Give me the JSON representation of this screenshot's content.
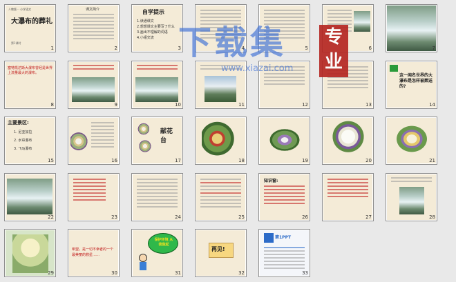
{
  "slides": [
    {
      "n": "1",
      "title": "大瀑布的葬礼"
    },
    {
      "n": "2",
      "text": "课文简介"
    },
    {
      "n": "3",
      "title": "自学提示",
      "items": [
        "1.读通课文",
        "2.想想课文主要写了什么",
        "3.画出不理解的词语",
        "4.小组交流"
      ]
    },
    {
      "n": "4"
    },
    {
      "n": "5"
    },
    {
      "n": "6"
    },
    {
      "n": "7"
    },
    {
      "n": "8",
      "text": "塞特凯达斯大瀑布曾经是世界上流量最大的瀑布。"
    },
    {
      "n": "9"
    },
    {
      "n": "10"
    },
    {
      "n": "11"
    },
    {
      "n": "12"
    },
    {
      "n": "13"
    },
    {
      "n": "14",
      "text": "这一闻名世界的大瀑布是怎样被葬送的?"
    },
    {
      "n": "15",
      "title": "主要景区:",
      "items": [
        "1. 尼亚加拉",
        "2. 水帘瀑布",
        "3. 飞马瀑布"
      ]
    },
    {
      "n": "16"
    },
    {
      "n": "17",
      "text": "献花台"
    },
    {
      "n": "18"
    },
    {
      "n": "19"
    },
    {
      "n": "20"
    },
    {
      "n": "21"
    },
    {
      "n": "22"
    },
    {
      "n": "23"
    },
    {
      "n": "24"
    },
    {
      "n": "25"
    },
    {
      "n": "26",
      "text": "知识窗:"
    },
    {
      "n": "27"
    },
    {
      "n": "28"
    },
    {
      "n": "29"
    },
    {
      "n": "30",
      "text": "希望，是一切不幸者的一个最美丽的救星……"
    },
    {
      "n": "31",
      "text": "保护环境 从我做起"
    },
    {
      "n": "32",
      "text": "再见!"
    },
    {
      "n": "33",
      "text": "第1PPT"
    }
  ],
  "watermark": {
    "main": "下载集",
    "badge": "专业",
    "url": "www.xiazai.com"
  }
}
